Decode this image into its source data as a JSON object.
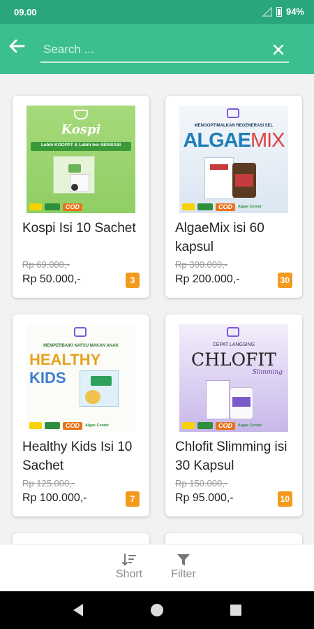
{
  "status": {
    "time": "09.00",
    "battery": "94%"
  },
  "search": {
    "placeholder": "Search ...",
    "value": ""
  },
  "products": [
    {
      "name": "Kospi Isi 10 Sachet",
      "old_price": "Rp 69.000,-",
      "price": "Rp 50.000,-",
      "count": "3",
      "image_title": "Kospi",
      "image_tagline": "Lebih KOOPAT & Lebih ber-SENSASI"
    },
    {
      "name": "AlgaeMix isi 60 kapsul",
      "old_price": "Rp 300.000,-",
      "price": "Rp 200.000,-",
      "count": "30",
      "image_title_a": "ALGAE",
      "image_title_b": "MIX",
      "image_tagline": "MENGOPTIMALKAN REGENERASI SEL"
    },
    {
      "name": "Healthy Kids Isi 10 Sachet",
      "old_price": "Rp 125.000,-",
      "price": "Rp 100.000,-",
      "count": "7",
      "image_title_a": "HEALTHY",
      "image_title_b": "KIDS",
      "image_tagline": "MEMPERBAIKI NAFSU MAKAN ANAK"
    },
    {
      "name": "Chlofit Slimming isi 30 Kapsul",
      "old_price": "Rp 150.000,-",
      "price": "Rp 95.000,-",
      "count": "10",
      "image_title": "CHLOFIT",
      "image_subtitle": "Slimming",
      "image_tagline": "CEPAT LANGSING"
    }
  ],
  "image_common": {
    "cod": "COD",
    "brand": "Algae Center"
  },
  "bottom": {
    "sort_label": "Short",
    "filter_label": "Filter"
  },
  "colors": {
    "statusbar": "#2aa77a",
    "appbar": "#3bbf8f",
    "badge": "#f39a1d"
  }
}
